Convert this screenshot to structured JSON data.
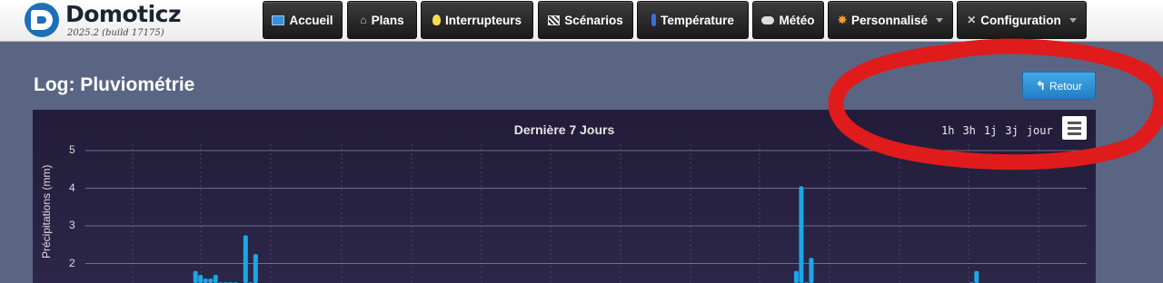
{
  "brand": {
    "name": "Domoticz",
    "version": "2025.2 (build 17175)"
  },
  "nav": [
    {
      "label": "Accueil",
      "icon": "dashboard-icon"
    },
    {
      "label": "Plans",
      "icon": "house-icon"
    },
    {
      "label": "Interrupteurs",
      "icon": "lightbulb-icon"
    },
    {
      "label": "Scénarios",
      "icon": "clapperboard-icon"
    },
    {
      "label": "Température",
      "icon": "thermometer-icon"
    },
    {
      "label": "Météo",
      "icon": "cloud-rain-icon"
    },
    {
      "label": "Personnalisé",
      "icon": "gear-icon",
      "dropdown": true
    },
    {
      "label": "Configuration",
      "icon": "tools-icon",
      "dropdown": true
    }
  ],
  "page": {
    "title": "Log: Pluviométrie",
    "back_label": "Retour"
  },
  "range_buttons": [
    "1h",
    "3h",
    "1j",
    "3j",
    "jour"
  ],
  "colors": {
    "background": "#5a6584",
    "chart_bg": "#221c3a",
    "series": "#1ba7e8",
    "annotation": "#e01b1b",
    "back_button": "#2d8fd5"
  },
  "chart_data": {
    "type": "bar",
    "title": "Dernière 7 Jours",
    "ylabel": "Précipitations (mm)",
    "ylim": [
      0,
      5
    ],
    "yticks": [
      2,
      3,
      4,
      5
    ],
    "grid": true,
    "series": [
      {
        "x": [
          0.11,
          0.115,
          0.12,
          0.125,
          0.13,
          0.135,
          0.14,
          0.145,
          0.15,
          0.155,
          0.16,
          0.165,
          0.17,
          0.71,
          0.715,
          0.72,
          0.725,
          0.885,
          0.89
        ],
        "values": [
          1.8,
          1.7,
          1.6,
          1.6,
          1.7,
          1.5,
          1.5,
          1.5,
          1.5,
          1.45,
          2.75,
          1.5,
          2.25,
          1.8,
          4.05,
          1.5,
          2.15,
          1.5,
          1.8
        ]
      }
    ]
  }
}
